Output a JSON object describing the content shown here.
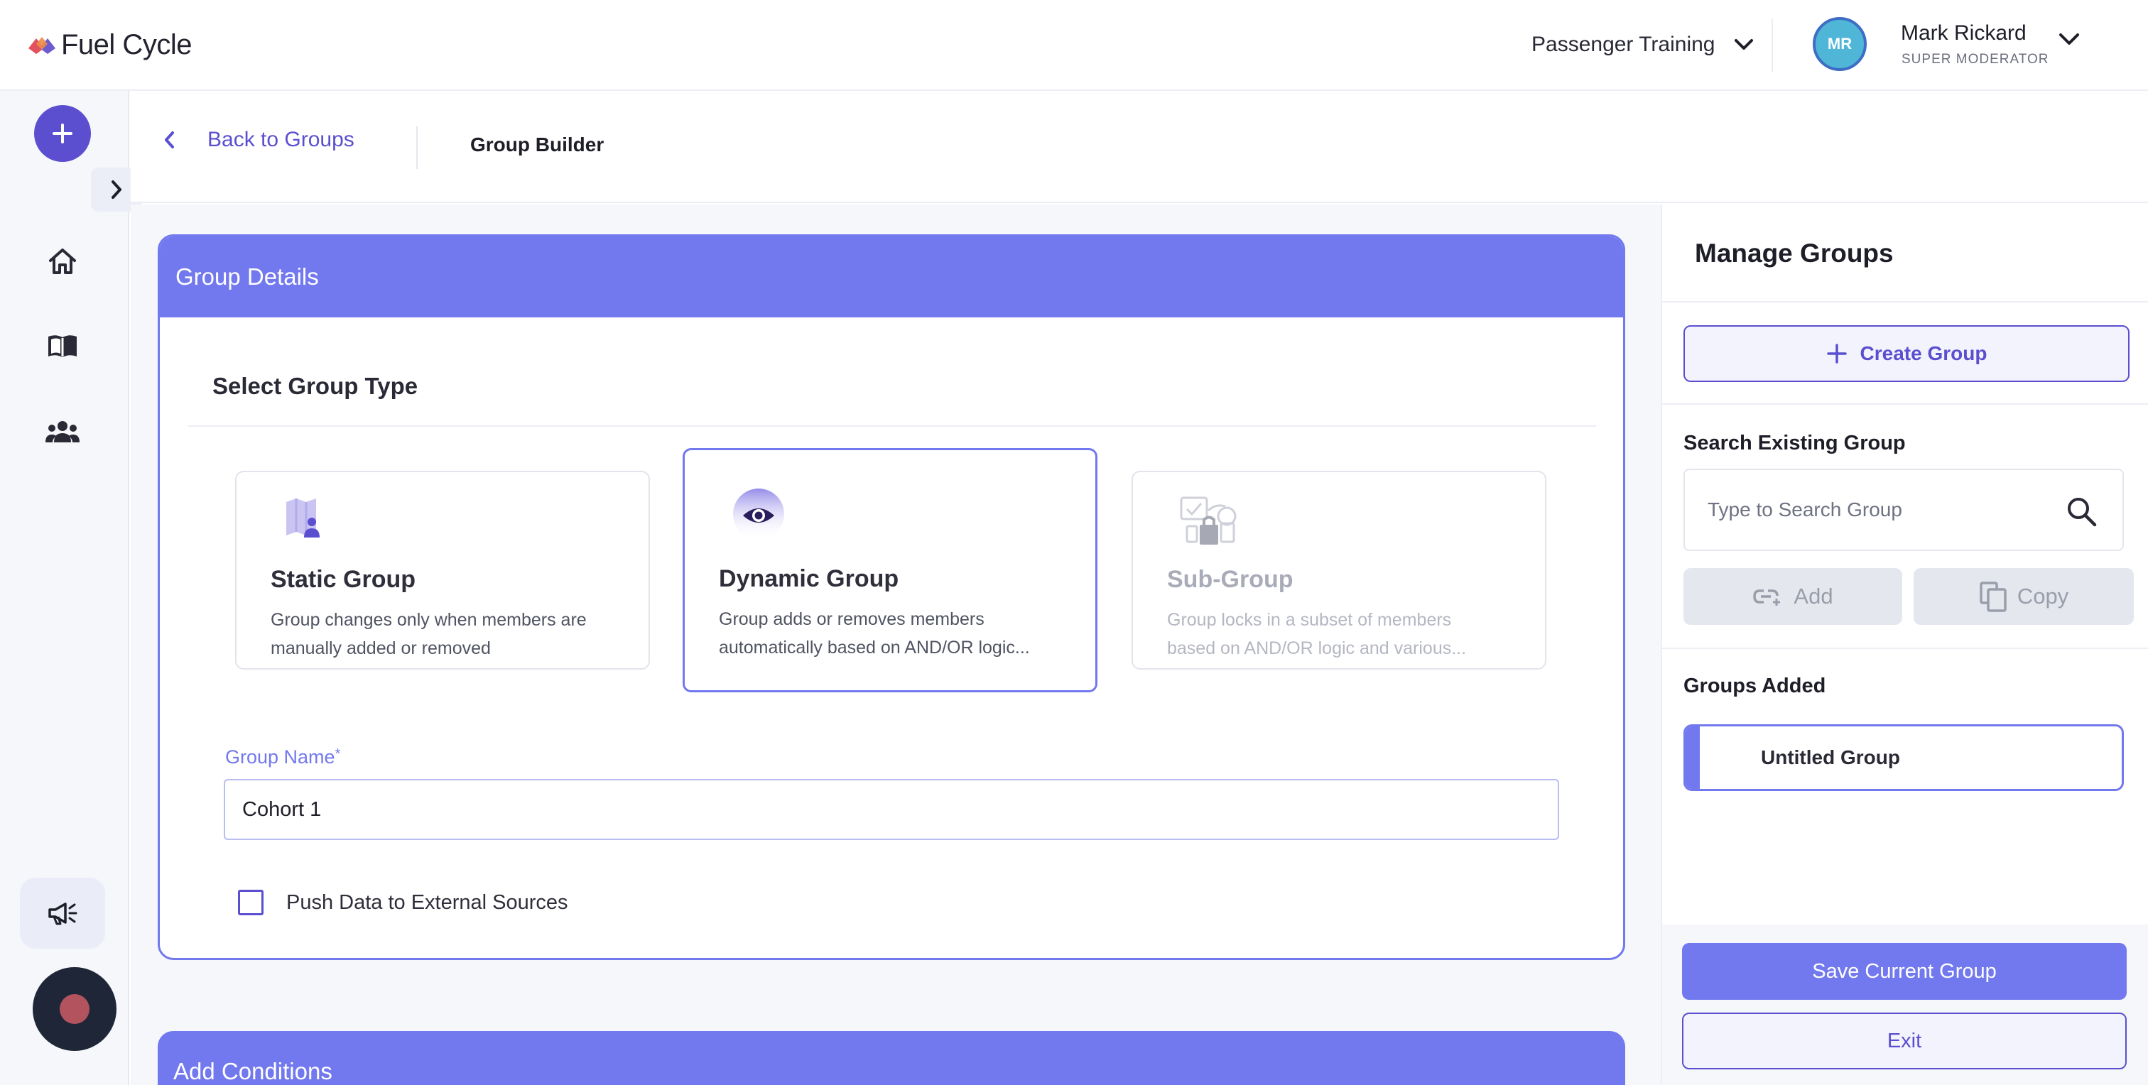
{
  "app": {
    "brand": "Fuel Cycle",
    "brand_colors": {
      "accent": "#7278ee",
      "primary": "#5b4fd0",
      "logo_left": "#e2515e",
      "logo_right": "#6c5ccf"
    }
  },
  "header": {
    "workspace": "Passenger Training",
    "user": {
      "initials": "MR",
      "name": "Mark Rickard",
      "role": "SUPER MODERATOR"
    }
  },
  "sidebar": {
    "icons": [
      "plus-icon",
      "chevron-right-icon",
      "home-icon",
      "book-icon",
      "people-icon",
      "megaphone-icon",
      "record-icon"
    ]
  },
  "subheader": {
    "back_label": "Back to Groups",
    "title": "Group Builder"
  },
  "details": {
    "header": "Group Details",
    "section_title": "Select Group Type",
    "types": [
      {
        "name": "Static Group",
        "desc_line1": "Group changes only when members are",
        "desc_line2": "manually added or removed",
        "icon": "map-user-icon",
        "state": "default"
      },
      {
        "name": "Dynamic Group",
        "desc_line1": "Group adds or removes members",
        "desc_line2": "automatically based on AND/OR logic...",
        "icon": "eye-icon",
        "state": "selected"
      },
      {
        "name": "Sub-Group",
        "desc_line1": "Group locks in a subset of members",
        "desc_line2": "based on AND/OR logic and various...",
        "icon": "lock-clipboard-icon",
        "state": "disabled"
      }
    ],
    "group_name_label": "Group Name",
    "required_mark": "*",
    "group_name_value": "Cohort 1",
    "push_label": "Push Data to External Sources",
    "push_checked": false
  },
  "conditions": {
    "header": "Add Conditions"
  },
  "manage": {
    "title": "Manage Groups",
    "create_label": "Create Group",
    "search_label": "Search Existing Group",
    "search_placeholder": "Type to Search Group",
    "add_label": "Add",
    "copy_label": "Copy",
    "added_label": "Groups Added",
    "groups": [
      {
        "name": "Untitled Group"
      }
    ],
    "save_label": "Save Current Group",
    "exit_label": "Exit"
  }
}
